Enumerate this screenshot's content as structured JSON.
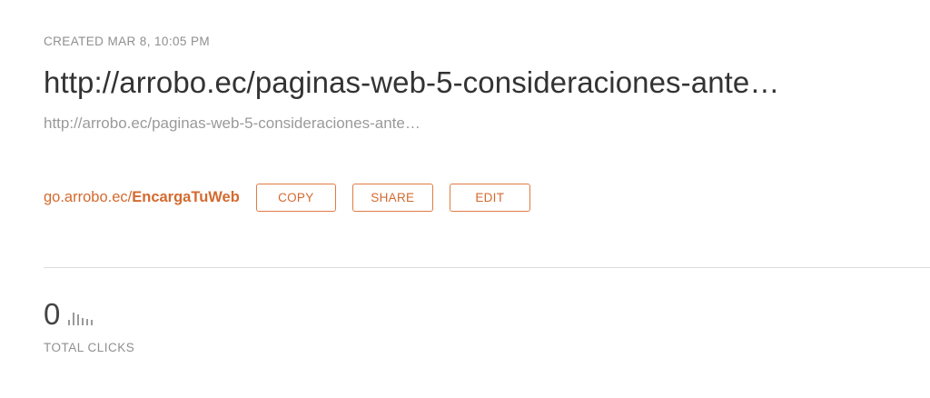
{
  "link": {
    "created": "CREATED MAR 8, 10:05 PM",
    "title": "http://arrobo.ec/paginas-web-5-consideraciones-ante…",
    "long_url": "http://arrobo.ec/paginas-web-5-consideraciones-ante…",
    "short_domain": "go.arrobo.ec/",
    "short_slug": "EncargaTuWeb"
  },
  "actions": {
    "copy_label": "COPY",
    "share_label": "SHARE",
    "edit_label": "EDIT"
  },
  "stats": {
    "clicks_count": "0",
    "clicks_label": "TOTAL CLICKS",
    "sparkline_icon": "bar-chart-icon",
    "sparkline_relative_levels": [
      0.45,
      1.0,
      0.85,
      0.6,
      0.5,
      0.4
    ]
  },
  "colors": {
    "accent": "#d46a2f",
    "text_dark": "#333333",
    "text_muted": "#8f8f8f",
    "divider": "#dcdcdc"
  }
}
